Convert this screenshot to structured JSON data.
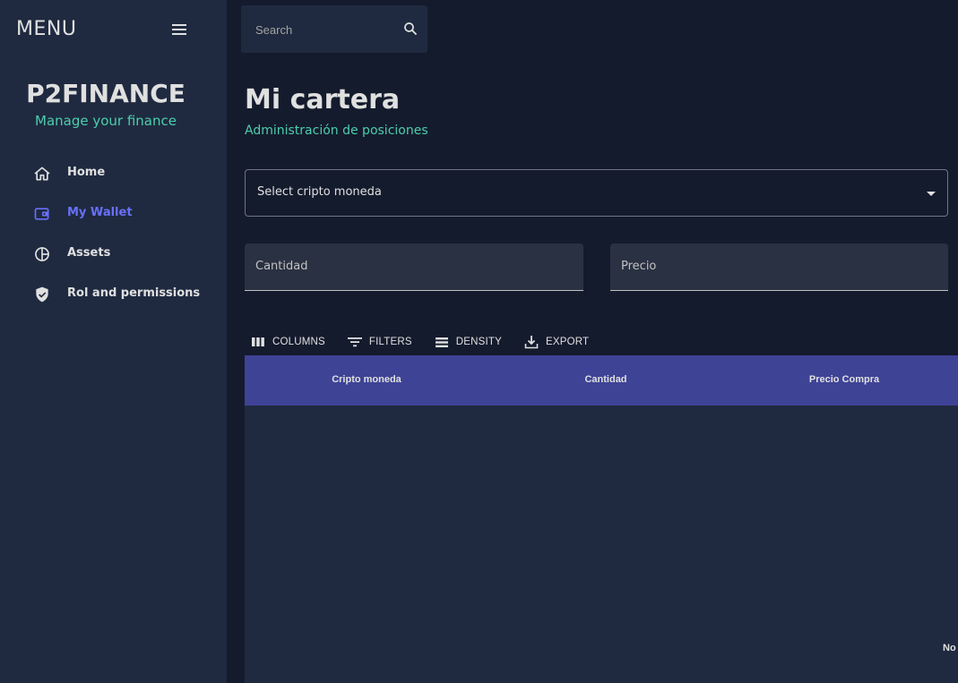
{
  "sidebar": {
    "menu_title": "MENU",
    "brand": "P2FINANCE",
    "tagline": "Manage your finance",
    "items": [
      {
        "label": "Home",
        "icon": "home-icon",
        "active": false
      },
      {
        "label": "My Wallet",
        "icon": "wallet-icon",
        "active": true
      },
      {
        "label": "Assets",
        "icon": "pie-chart-icon",
        "active": false
      },
      {
        "label": "Rol and permissions",
        "icon": "shield-icon",
        "active": false
      }
    ]
  },
  "search": {
    "placeholder": "Search",
    "icon": "search-icon"
  },
  "header": {
    "title": "Mi cartera",
    "subtitle": "Administración de posiciones"
  },
  "form": {
    "select_placeholder": "Select cripto moneda",
    "cantidad_label": "Cantidad",
    "precio_label": "Precio"
  },
  "toolbar": {
    "columns": "COLUMNS",
    "filters": "FILTERS",
    "density": "DENSITY",
    "export": "EXPORT"
  },
  "grid": {
    "columns": [
      "Cripto moneda",
      "Cantidad",
      "Precio Compra"
    ],
    "empty_text": "No"
  },
  "colors": {
    "accent_green": "#4cceac",
    "active_nav": "#6870fa",
    "grid_header": "#3e4396",
    "sidebar_bg": "#1f2a40",
    "page_bg": "#141b2d"
  }
}
